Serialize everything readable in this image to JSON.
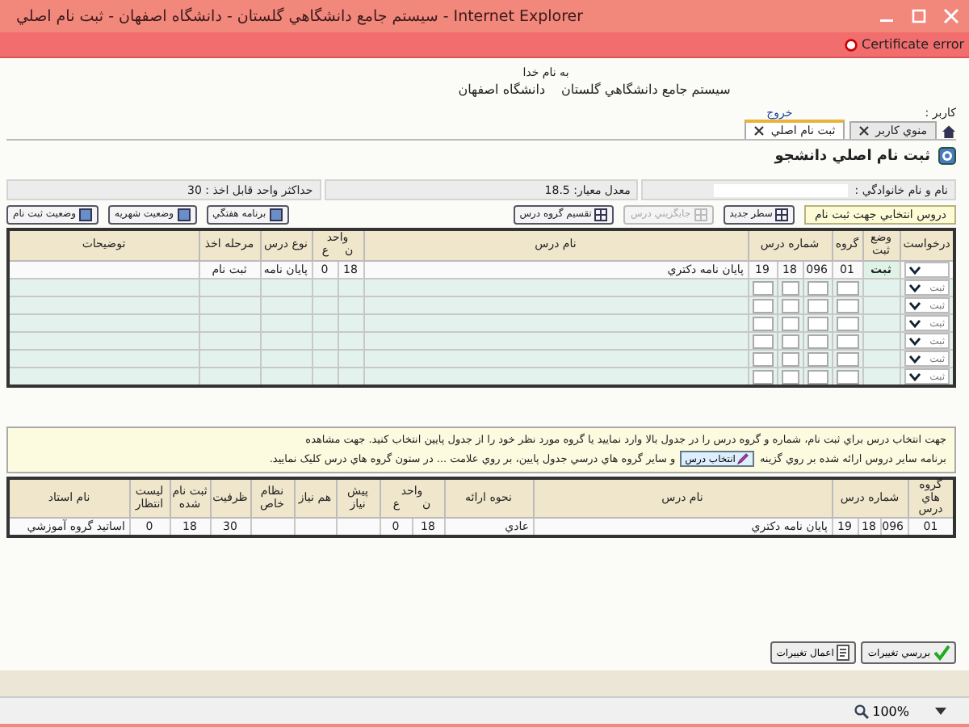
{
  "window": {
    "title": "سیستم جامع دانشگاهي گلستان - دانشگاه اصفهان - ثبت نام اصلي - Internet Explorer",
    "certificate_error": "Certificate error"
  },
  "header": {
    "greeting": "به نام خدا",
    "system_name": "سیستم جامع دانشگاهي گلستان",
    "university": "دانشگاه اصفهان",
    "user_label": "كاربر :",
    "logout": "خروج"
  },
  "tabs": [
    {
      "label": "منوي كاربر",
      "selected": false
    },
    {
      "label": "ثبت نام اصلي",
      "selected": true
    }
  ],
  "page_title": "ثبت نام اصلي دانشجو",
  "info": {
    "name_label": "نام و نام خانوادگي :",
    "gpa": "معدل معيار: 18.5",
    "max_units": "حداكثر واحد قابل اخذ : 30"
  },
  "toolbar": {
    "caption": "دروس انتخابي جهت ثبت نام",
    "buttons": [
      {
        "label": "سطر جديد",
        "disabled": false
      },
      {
        "label": "جايگزيني درس",
        "disabled": true
      },
      {
        "label": "تقسيم گروه درس",
        "disabled": false
      }
    ],
    "side_buttons": [
      {
        "label": "برنامه هفتگي"
      },
      {
        "label": "وضعيت شهريه"
      },
      {
        "label": "وضعيت ثبت نام"
      }
    ]
  },
  "selected_table": {
    "columns": {
      "request": "درخواست",
      "status": "وضع ثبت",
      "group": "گروه",
      "course_no": "شماره درس",
      "name": "نام درس",
      "units": "واحد",
      "units_t": "ن",
      "units_p": "ع",
      "type": "نوع درس",
      "stage": "مرحله اخذ",
      "notes": "توضيحات"
    },
    "rows": [
      {
        "kind": "filled",
        "status": "ثبت",
        "group": "01",
        "course_no": [
          "096",
          "18",
          "19"
        ],
        "name": "پايان نامه دكتري",
        "units": [
          "18",
          "0"
        ],
        "type": "پايان نامه",
        "stage": "ثبت نام"
      },
      {
        "kind": "empty",
        "request": "ثبت"
      },
      {
        "kind": "empty",
        "request": "ثبت"
      },
      {
        "kind": "empty",
        "request": "ثبت"
      },
      {
        "kind": "empty",
        "request": "ثبت"
      },
      {
        "kind": "empty",
        "request": "ثبت"
      },
      {
        "kind": "empty",
        "request": "ثبت"
      }
    ]
  },
  "hint": {
    "line1": "جهت انتخاب درس براي ثبت نام، شماره و گروه درس را در جدول بالا وارد نماييد يا گروه مورد نظر خود را از جدول پايين انتخاب كنيد. جهت مشاهده",
    "line2_before": "برنامه ساير دروس ارائه شده بر روي گزينه",
    "button": "انتخاب درس",
    "line2_after": "و ساير گروه هاي درسي جدول پايين، بر روي علامت ... در ستون گروه هاي درس كليک نماييد."
  },
  "offered_table": {
    "columns": {
      "group": "گروه هاي درس",
      "course_no": "شماره درس",
      "name": "نام درس",
      "method": "نحوه ارائه",
      "units": "واحد",
      "units_t": "ن",
      "units_p": "ع",
      "prereq": "پيش نياز",
      "coreq": "هم نياز",
      "special": "نظام خاص",
      "capacity": "ظرفيت",
      "registered": "ثبت نام شده",
      "waitlist": "ليست انتظار",
      "teacher": "نام استاد"
    },
    "rows": [
      {
        "group": "01",
        "course_no": [
          "096",
          "18",
          "19"
        ],
        "name": "پايان نامه دكتري",
        "method": "عادي",
        "units": [
          "18",
          "0"
        ],
        "capacity": "30",
        "registered": "18",
        "waitlist": "0",
        "teacher": "اساتيد گروه آموزشي"
      }
    ]
  },
  "actions": [
    {
      "label": "بررسي تغييرات",
      "kind": "check"
    },
    {
      "label": "اعمال تغييرات",
      "kind": "apply"
    }
  ],
  "status_bar": {
    "zoom": "100%"
  }
}
